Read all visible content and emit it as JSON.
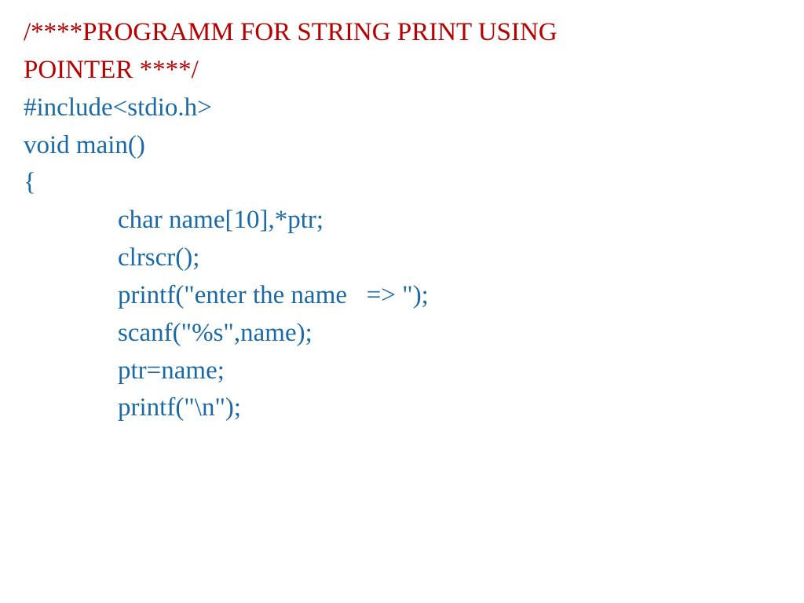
{
  "code": {
    "comment_line1": "/****PROGRAMM FOR STRING PRINT USING",
    "comment_line2": "POINTER ****/",
    "line1": "#include<stdio.h>",
    "line2": "void main()",
    "line3": "{",
    "line4": "char name[10],*ptr;",
    "line5": "clrscr();",
    "line6": "printf(\"enter the name   => \");",
    "line7": "scanf(\"%s\",name);",
    "line8": "ptr=name;",
    "line9": "printf(\"\\n\");"
  }
}
